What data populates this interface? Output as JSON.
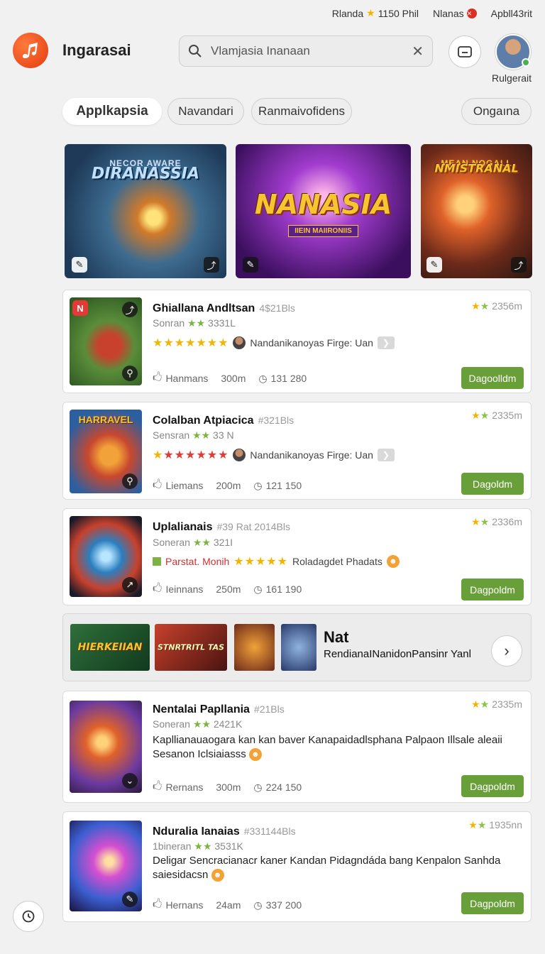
{
  "status_bar": {
    "item1": "Rlanda",
    "item1b": "1150 Phil",
    "item2": "Nlanas",
    "item3": "Apbll43rit"
  },
  "header": {
    "app_title": "Ingarasai",
    "search_placeholder": "Vlamjasia Inanaan",
    "user_name": "Rulgerait"
  },
  "tabs": [
    {
      "label": "Applkapsia"
    },
    {
      "label": "Navandari"
    },
    {
      "label": "Ranmaivofidens"
    },
    {
      "label": "Ongaına"
    }
  ],
  "banners": [
    {
      "title": "DIRANASSIA",
      "sub": "NECOR AWARE"
    },
    {
      "title": "NANASIA",
      "tag": "IIEIN MAIIRONIIS"
    },
    {
      "title": "NMISTRANAL",
      "sub": "MEAN NOGALL"
    }
  ],
  "cards": [
    {
      "name": "Ghiallana Andltsan",
      "note": "4$21Bls",
      "sub": "Sonran",
      "sub2": "3331L",
      "rating": "2356m",
      "line": "Nandanikanoyas Firge: Uan",
      "meta1": "Hanmans",
      "meta2": "300m",
      "meta3": "131 280",
      "button": "Dagoolldm",
      "thumb_badge": "N"
    },
    {
      "name": "Colalban Atpiacica",
      "note": "#321Bls",
      "sub": "Sensran",
      "sub2": "33 N",
      "rating": "2335m",
      "line": "Nandanikanoyas Firge: Uan",
      "meta1": "Liemans",
      "meta2": "200m",
      "meta3": "121 150",
      "button": "Dagoldm",
      "thumb_title": "HARRAVEL"
    },
    {
      "name": "Uplalianais",
      "note": "#39 Rat 2014Bls",
      "sub": "Soneran",
      "sub2": "321I",
      "rating": "2336m",
      "tag": "Parstat. Monih",
      "line": "Roladagdet Phadats",
      "meta1": "Ieinnans",
      "meta2": "250m",
      "meta3": "161 190",
      "button": "Dagpoldm"
    },
    {
      "name": "Nentalai Papllania",
      "note": "#21Bls",
      "sub": "Soneran",
      "sub2": "2421K",
      "rating": "2335m",
      "desc": "Kapllianauaogara kan kan baver Kanapaidadlsphana Palpaon Illsale aleaii Sesanon Iclsiaiasss",
      "meta1": "Rernans",
      "meta2": "300m",
      "meta3": "224 150",
      "button": "Dagpoldm"
    },
    {
      "name": "Nduralia Ianaias",
      "note": "#331144Bls",
      "sub": "1bineran",
      "sub2": "3531K",
      "rating": "1935nn",
      "desc": "Deligar Sencracianacr kaner Kandan Pidagndáda bang Kenpalon Sanhda saiesidacsn",
      "meta1": "Hernans",
      "meta2": "24am",
      "meta3": "337 200",
      "button": "Dagpoldm"
    }
  ],
  "promo": {
    "title": "Nat",
    "subtitle": "RendianaINanidonPansinr Yanl",
    "mini1": "HIERKEIIAN",
    "mini2": "STNRTRITL TAS"
  },
  "colors": {
    "accent": "#689f38",
    "logo": "#e8431a",
    "star": "#f4b400"
  }
}
